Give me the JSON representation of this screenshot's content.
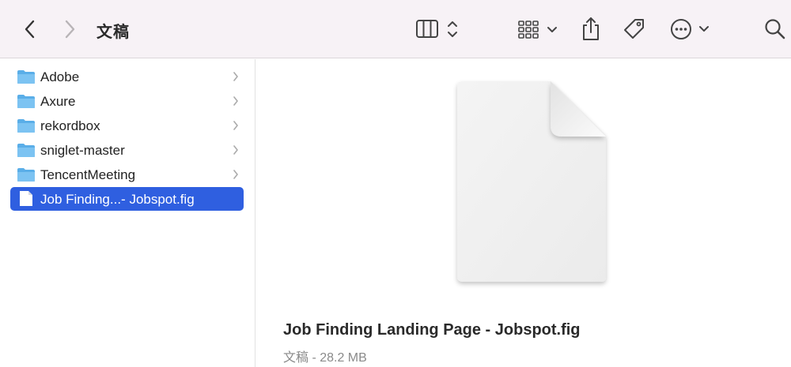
{
  "window": {
    "title": "文稿"
  },
  "sidebar": {
    "items": [
      {
        "label": "Adobe",
        "kind": "folder"
      },
      {
        "label": "Axure",
        "kind": "folder"
      },
      {
        "label": "rekordbox",
        "kind": "folder"
      },
      {
        "label": "sniglet-master",
        "kind": "folder"
      },
      {
        "label": "TencentMeeting",
        "kind": "folder"
      },
      {
        "label": "Job Finding...- Jobspot.fig",
        "kind": "file",
        "selected": true
      }
    ]
  },
  "preview": {
    "file_name": "Job Finding Landing Page - Jobspot.fig",
    "file_meta": "文稿 - 28.2 MB"
  },
  "colors": {
    "toolbar_bg": "#f7f2f6",
    "selection": "#2f5fe0",
    "folder": "#5aaee8"
  },
  "icons": {
    "back": "chevron-left-icon",
    "forward": "chevron-right-icon",
    "view_columns": "columns-view-icon",
    "group": "grid-group-icon",
    "share": "share-icon",
    "tag": "tag-icon",
    "more": "ellipsis-circle-icon",
    "search": "search-icon"
  }
}
